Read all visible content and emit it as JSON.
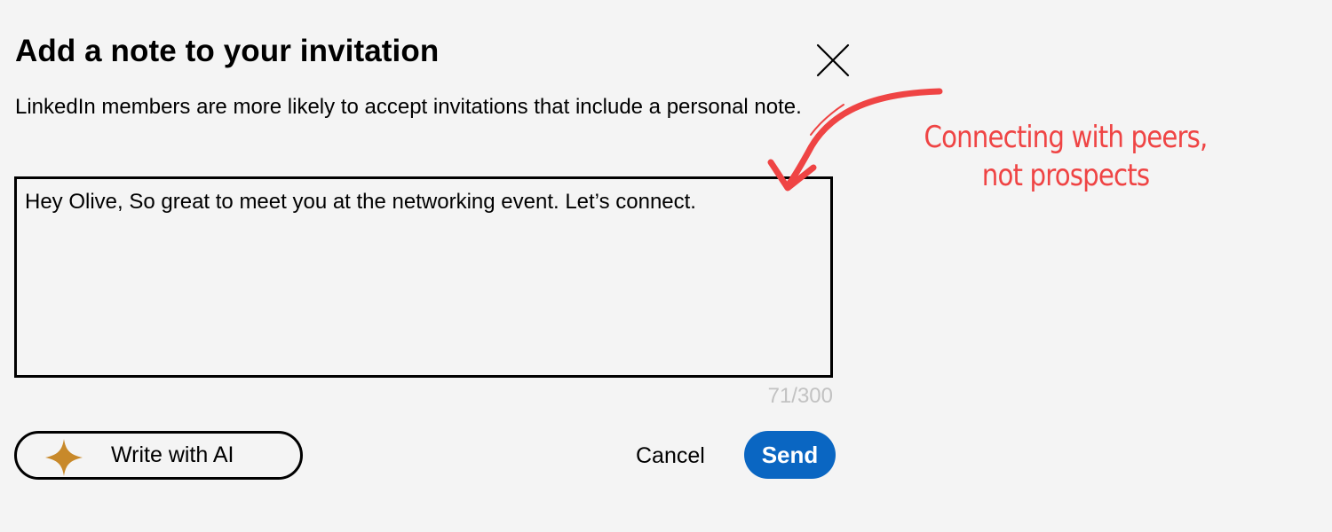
{
  "dialog": {
    "title": "Add a note to your invitation",
    "description": "LinkedIn members are more likely to accept invitations that include a personal note.",
    "close_icon": "close-icon"
  },
  "note": {
    "value": "Hey Olive, So great to meet you at the networking event. Let’s connect.",
    "char_count": "71/300"
  },
  "actions": {
    "write_ai_label": "Write with AI",
    "write_ai_icon": "sparkle-icon",
    "cancel_label": "Cancel",
    "send_label": "Send"
  },
  "annotation": {
    "line1": "Connecting with peers,",
    "line2": "not prospects",
    "arrow_icon": "curved-arrow-icon"
  },
  "colors": {
    "background": "#f4f4f4",
    "send_button": "#0a66c2",
    "sparkle": "#c8892a",
    "annotation": "#ef4444",
    "counter_text": "#c2c2c2"
  }
}
